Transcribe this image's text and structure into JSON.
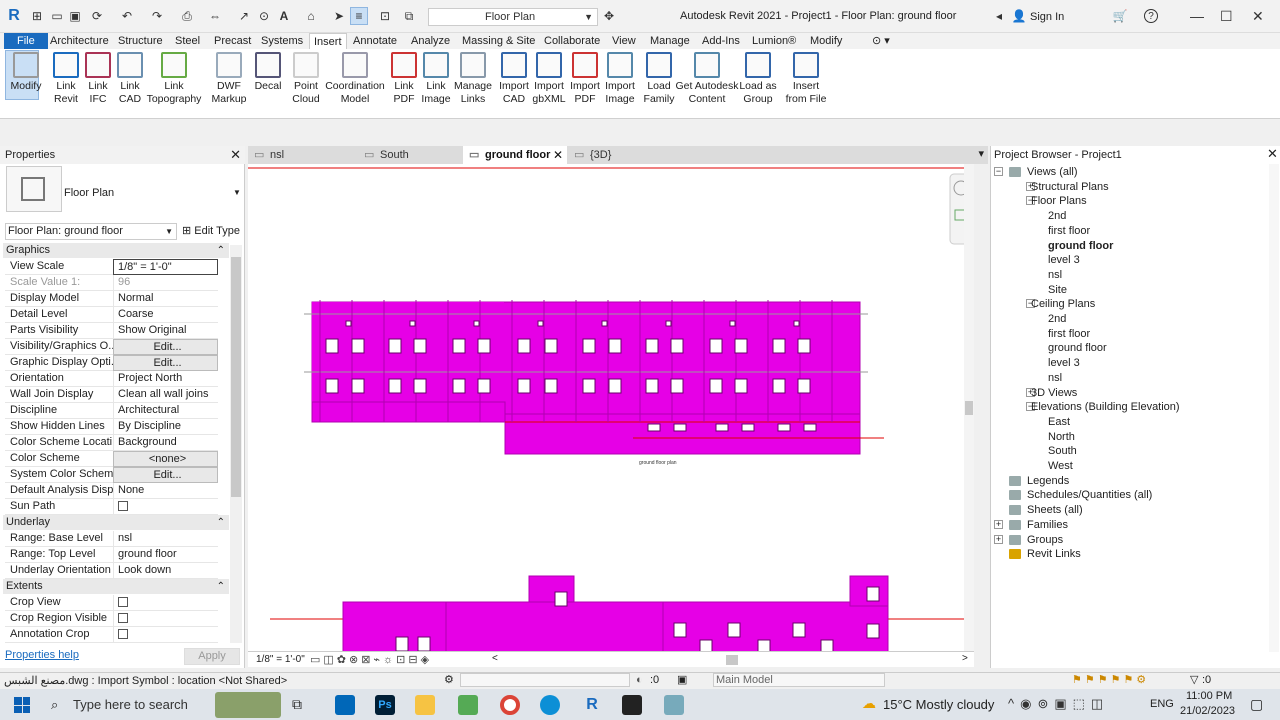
{
  "titlebar": {
    "view_combo": "Floor Plan",
    "title": "Autodesk Revit 2021 - Project1 - Floor Plan: ground floor",
    "sign_in": "Sign In",
    "help": "?",
    "minimize": "—",
    "maximize": "☐",
    "close": "✕"
  },
  "ribbon_tabs": [
    "File",
    "Architecture",
    "Structure",
    "Steel",
    "Precast",
    "Systems",
    "Insert",
    "Annotate",
    "Analyze",
    "Massing & Site",
    "Collaborate",
    "View",
    "Manage",
    "Add-Ins",
    "Lumion®",
    "Modify"
  ],
  "active_tab": "Insert",
  "ribbon_buttons": [
    {
      "label": "Modify",
      "icon": "cursor-icon"
    },
    {
      "label": "Link\nRevit",
      "icon": "link-revit-icon"
    },
    {
      "label": "Link\nIFC",
      "icon": "link-ifc-icon"
    },
    {
      "label": "Link\nCAD",
      "icon": "link-cad-icon"
    },
    {
      "label": "Link\nTopography",
      "icon": "topography-icon"
    },
    {
      "label": "DWF\nMarkup",
      "icon": "dwf-icon"
    },
    {
      "label": "Decal",
      "icon": "decal-icon"
    },
    {
      "label": "Point\nCloud",
      "icon": "point-cloud-icon"
    },
    {
      "label": "Coordination\nModel",
      "icon": "coordination-icon"
    },
    {
      "label": "Link\nPDF",
      "icon": "pdf-icon"
    },
    {
      "label": "Link\nImage",
      "icon": "image-icon"
    },
    {
      "label": "Manage\nLinks",
      "icon": "manage-links-icon"
    },
    {
      "label": "Import\nCAD",
      "icon": "import-cad-icon"
    },
    {
      "label": "Import\ngbXML",
      "icon": "gbxml-icon"
    },
    {
      "label": "Import\nPDF",
      "icon": "import-pdf-icon"
    },
    {
      "label": "Import\nImage",
      "icon": "import-image-icon"
    },
    {
      "label": "Load\nFamily",
      "icon": "load-family-icon"
    },
    {
      "label": "Get Autodesk\nContent",
      "icon": "autodesk-content-icon"
    },
    {
      "label": "Load as\nGroup",
      "icon": "load-group-icon"
    },
    {
      "label": "Insert\nfrom File",
      "icon": "insert-file-icon"
    }
  ],
  "properties": {
    "title": "Properties",
    "type_name": "Floor Plan",
    "instance_selector": "Floor Plan: ground floor",
    "edit_type": "Edit Type",
    "sections": [
      {
        "name": "Graphics",
        "rows": [
          {
            "k": "View Scale",
            "v": "1/8\" = 1'-0\"",
            "kind": "input"
          },
          {
            "k": "Scale Value    1:",
            "v": "96",
            "kind": "gray"
          },
          {
            "k": "Display Model",
            "v": "Normal"
          },
          {
            "k": "Detail Level",
            "v": "Coarse"
          },
          {
            "k": "Parts Visibility",
            "v": "Show Original"
          },
          {
            "k": "Visibility/Graphics O...",
            "v": "Edit...",
            "kind": "btn"
          },
          {
            "k": "Graphic Display Opti...",
            "v": "Edit...",
            "kind": "btn"
          },
          {
            "k": "Orientation",
            "v": "Project North"
          },
          {
            "k": "Wall Join Display",
            "v": "Clean all wall joins"
          },
          {
            "k": "Discipline",
            "v": "Architectural"
          },
          {
            "k": "Show Hidden Lines",
            "v": "By Discipline"
          },
          {
            "k": "Color Scheme Locati...",
            "v": "Background"
          },
          {
            "k": "Color Scheme",
            "v": "<none>",
            "kind": "btn"
          },
          {
            "k": "System Color Schemes",
            "v": "Edit...",
            "kind": "btn"
          },
          {
            "k": "Default Analysis Disp...",
            "v": "None"
          },
          {
            "k": "Sun Path",
            "v": "",
            "kind": "cb"
          }
        ]
      },
      {
        "name": "Underlay",
        "rows": [
          {
            "k": "Range: Base Level",
            "v": "nsl"
          },
          {
            "k": "Range: Top Level",
            "v": "ground floor"
          },
          {
            "k": "Underlay Orientation",
            "v": "Look down"
          }
        ]
      },
      {
        "name": "Extents",
        "rows": [
          {
            "k": "Crop View",
            "v": "",
            "kind": "cb"
          },
          {
            "k": "Crop Region Visible",
            "v": "",
            "kind": "cb"
          },
          {
            "k": "Annotation Crop",
            "v": "",
            "kind": "cb"
          }
        ]
      }
    ],
    "help_link": "Properties help",
    "apply": "Apply"
  },
  "view_tabs": [
    {
      "label": "nsl",
      "icon": "floor-plan-icon"
    },
    {
      "label": "South",
      "icon": "elevation-icon"
    },
    {
      "label": "ground floor",
      "icon": "floor-plan-icon",
      "active": true
    },
    {
      "label": "{3D}",
      "icon": "3d-view-icon"
    }
  ],
  "canvas": {
    "drawing_label": "ground floor plan",
    "scale": "1/8\" = 1'-0\""
  },
  "browser": {
    "title": "Project Browser - Project1",
    "nodes": [
      {
        "label": "Views (all)",
        "level": 0,
        "exp": "−",
        "icon": true
      },
      {
        "label": "Structural Plans",
        "level": 1,
        "exp": "+"
      },
      {
        "label": "Floor Plans",
        "level": 1,
        "exp": "−"
      },
      {
        "label": "2nd",
        "level": 2
      },
      {
        "label": "first floor",
        "level": 2
      },
      {
        "label": "ground floor",
        "level": 2,
        "bold": true
      },
      {
        "label": "level 3",
        "level": 2
      },
      {
        "label": "nsl",
        "level": 2
      },
      {
        "label": "Site",
        "level": 2
      },
      {
        "label": "Ceiling Plans",
        "level": 1,
        "exp": "−"
      },
      {
        "label": "2nd",
        "level": 2
      },
      {
        "label": "first floor",
        "level": 2
      },
      {
        "label": "ground floor",
        "level": 2
      },
      {
        "label": "level 3",
        "level": 2
      },
      {
        "label": "nsl",
        "level": 2
      },
      {
        "label": "3D Views",
        "level": 1,
        "exp": "+"
      },
      {
        "label": "Elevations (Building Elevation)",
        "level": 1,
        "exp": "−"
      },
      {
        "label": "East",
        "level": 2
      },
      {
        "label": "North",
        "level": 2
      },
      {
        "label": "South",
        "level": 2
      },
      {
        "label": "West",
        "level": 2
      },
      {
        "label": "Legends",
        "level": 0,
        "icon": true
      },
      {
        "label": "Schedules/Quantities (all)",
        "level": 0,
        "icon": true
      },
      {
        "label": "Sheets (all)",
        "level": 0,
        "icon": true
      },
      {
        "label": "Families",
        "level": 0,
        "exp": "+",
        "icon": true
      },
      {
        "label": "Groups",
        "level": 0,
        "exp": "+",
        "icon": true
      },
      {
        "label": "Revit Links",
        "level": 0,
        "icon": true
      }
    ]
  },
  "status": {
    "text": "مصنع الشبس.dwg : Import Symbol : location <Not Shared>",
    "zero1": ":0",
    "model": "Main Model",
    "filter": ":0"
  },
  "taskbar": {
    "search": "Type here to search",
    "weather": "15°C  Mostly cloudy",
    "lang": "ENG",
    "time": "11:00 PM",
    "date": "21/02/2023"
  },
  "colors": {
    "accent": "#1a6bbf",
    "wall": "#e600e6",
    "wall_stroke": "#b000b0",
    "selection": "#e00000"
  }
}
